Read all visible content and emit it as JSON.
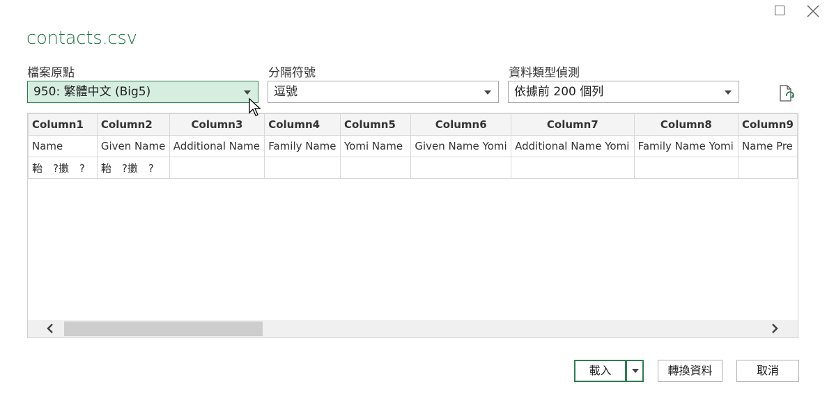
{
  "window": {
    "title": "contacts.csv"
  },
  "options": {
    "file_origin": {
      "label": "檔案原點",
      "value": "950: 繁體中文 (Big5)"
    },
    "delimiter": {
      "label": "分隔符號",
      "value": "逗號"
    },
    "type_detection": {
      "label": "資料類型偵測",
      "value": "依據前 200 個列"
    }
  },
  "preview": {
    "columns": [
      "Column1",
      "Column2",
      "Column3",
      "Column4",
      "Column5",
      "Column6",
      "Column7",
      "Column8",
      "Column9"
    ],
    "rows": [
      [
        "Name",
        "Given Name",
        "Additional Name",
        "Family Name",
        "Yomi Name",
        "Given Name Yomi",
        "Additional Name Yomi",
        "Family Name Yomi",
        "Name Pre"
      ],
      [
        "軩　?擻　?",
        "軩　?擻　?",
        "",
        "",
        "",
        "",
        "",
        "",
        ""
      ]
    ]
  },
  "buttons": {
    "load": "載入",
    "transform": "轉換資料",
    "cancel": "取消"
  },
  "icons": {
    "maximize": "maximize-icon",
    "close": "close-icon",
    "refresh": "refresh-file-icon",
    "scroll_left": "chevron-left-icon",
    "scroll_right": "chevron-right-icon"
  },
  "colors": {
    "accent": "#217346",
    "selected_bg": "#d5eee0"
  }
}
